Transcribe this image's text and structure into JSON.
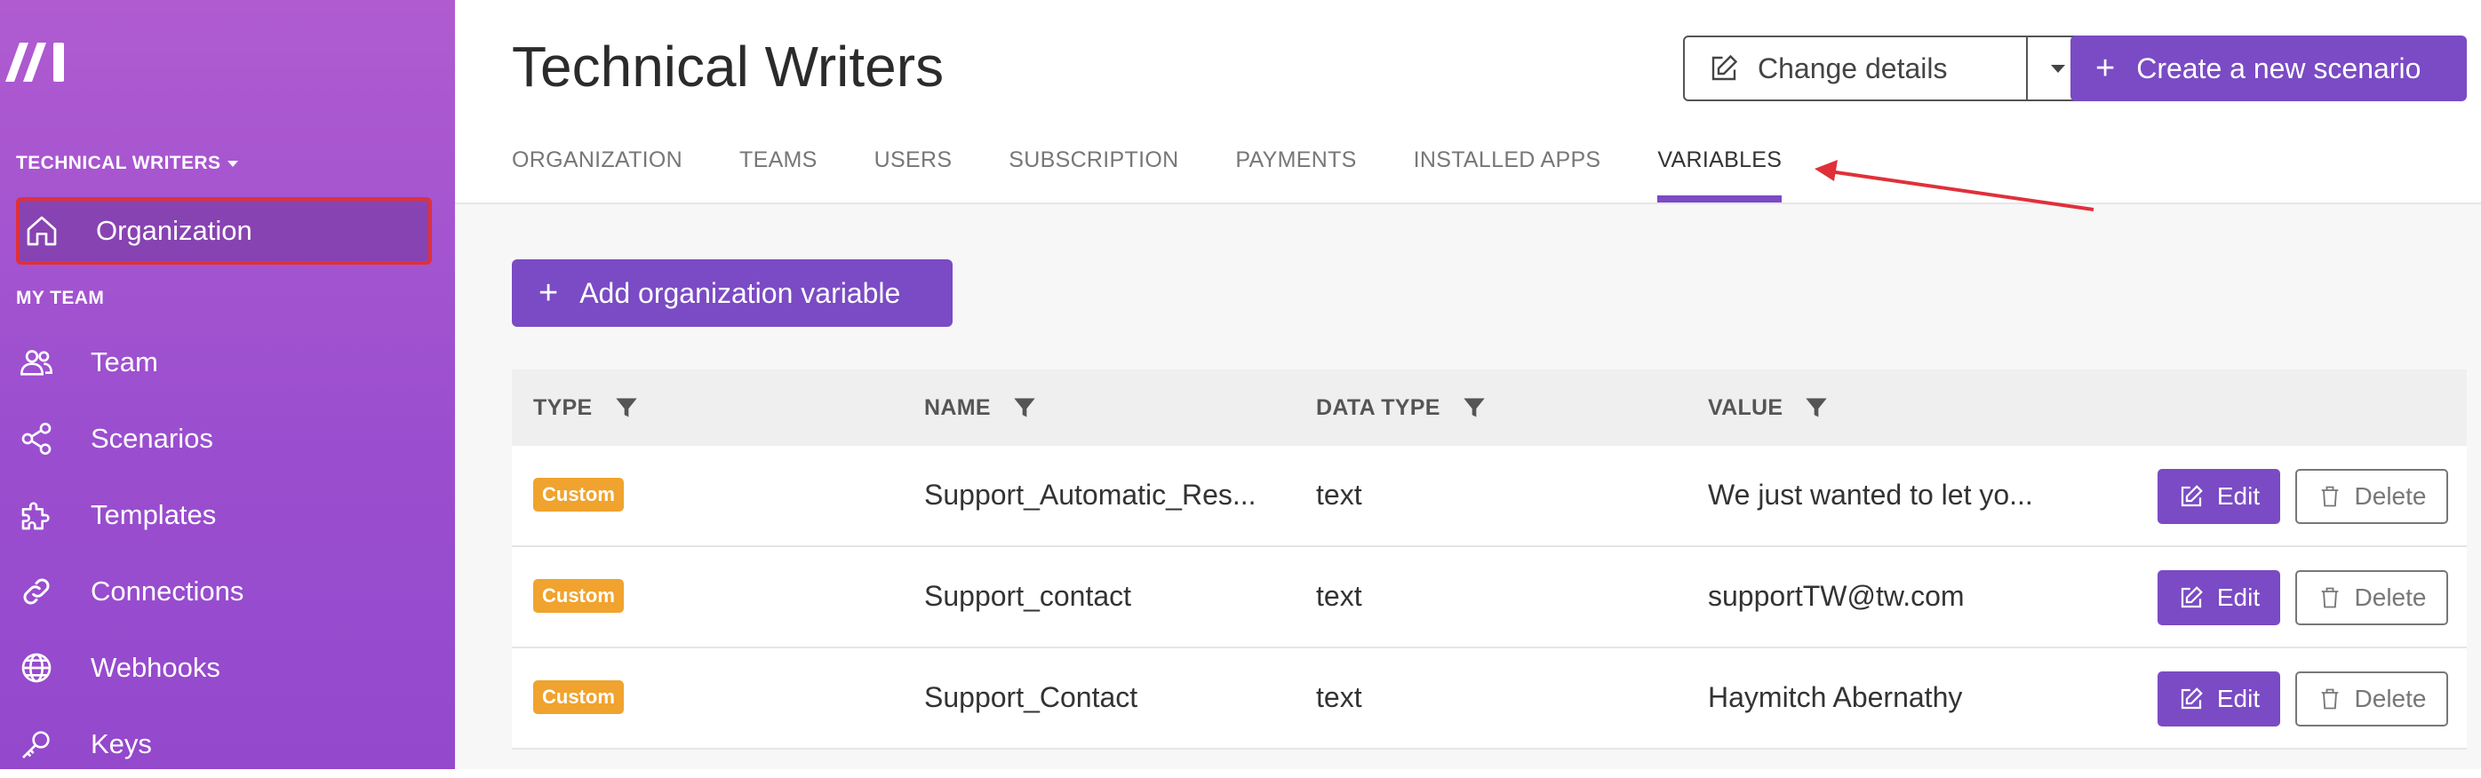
{
  "sidebar": {
    "org_name": "TECHNICAL WRITERS",
    "section_label": "MY TEAM",
    "items": [
      {
        "label": "Organization",
        "icon": "home-icon"
      },
      {
        "label": "Team",
        "icon": "users-icon"
      },
      {
        "label": "Scenarios",
        "icon": "share-icon"
      },
      {
        "label": "Templates",
        "icon": "puzzle-icon"
      },
      {
        "label": "Connections",
        "icon": "link-icon"
      },
      {
        "label": "Webhooks",
        "icon": "globe-icon"
      },
      {
        "label": "Keys",
        "icon": "key-icon"
      }
    ]
  },
  "header": {
    "title": "Technical Writers",
    "change_details": "Change details",
    "create_scenario": "Create a new scenario",
    "tabs": [
      "ORGANIZATION",
      "TEAMS",
      "USERS",
      "SUBSCRIPTION",
      "PAYMENTS",
      "INSTALLED APPS",
      "VARIABLES"
    ],
    "active_tab": "VARIABLES"
  },
  "main": {
    "add_button": "Add organization variable",
    "columns": [
      "TYPE",
      "NAME",
      "DATA TYPE",
      "VALUE"
    ],
    "rows": [
      {
        "type": "Custom",
        "name": "Support_Automatic_Res...",
        "data_type": "text",
        "value": "We just wanted to let yo...",
        "edit": "Edit",
        "delete": "Delete"
      },
      {
        "type": "Custom",
        "name": "Support_contact",
        "data_type": "text",
        "value": "supportTW@tw.com",
        "edit": "Edit",
        "delete": "Delete"
      },
      {
        "type": "Custom",
        "name": "Support_Contact",
        "data_type": "text",
        "value": "Haymitch Abernathy",
        "edit": "Edit",
        "delete": "Delete"
      }
    ]
  },
  "colors": {
    "accent": "#7a4bc4",
    "badge": "#f0a32e",
    "highlight": "#e0303a",
    "sidebar": "#9b4fcf"
  }
}
